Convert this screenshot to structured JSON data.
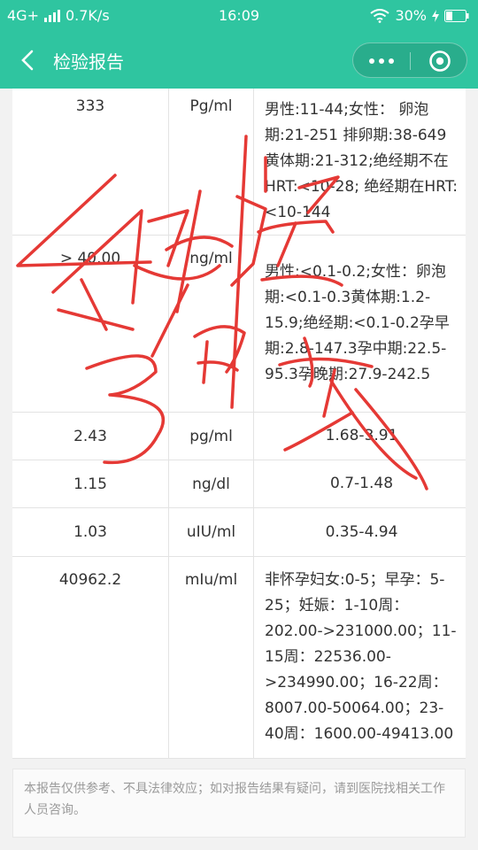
{
  "status_bar": {
    "network": "4G+",
    "speed": "0.7K/s",
    "time": "16:09",
    "battery": "30%"
  },
  "nav": {
    "title": "检验报告"
  },
  "rows": [
    {
      "value": "333",
      "unit": "Pg/ml",
      "reference": "男性:11-44;女性： 卵泡期:21-251 排卵期:38-649 黄体期:21-312;绝经期不在HRT:<10-28; 绝经期在HRT:<10-144"
    },
    {
      "value": "> 40.00",
      "unit": "ng/ml",
      "reference": "男性:<0.1-0.2;女性：卵泡期:<0.1-0.3黄体期:1.2-15.9;绝经期:<0.1-0.2孕早期:2.8-147.3孕中期:22.5-95.3孕晚期:27.9-242.5"
    },
    {
      "value": "2.43",
      "unit": "pg/ml",
      "reference": "1.68-3.91"
    },
    {
      "value": "1.15",
      "unit": "ng/dl",
      "reference": "0.7-1.48"
    },
    {
      "value": "1.03",
      "unit": "uIU/ml",
      "reference": "0.35-4.94"
    },
    {
      "value": "40962.2",
      "unit": "mIu/ml",
      "reference": "非怀孕妇女:0-5；早孕：5-25；妊娠：1-10周：202.00->231000.00；11-15周：22536.00->234990.00；16-22周：8007.00-50064.00；23-40周：1600.00-49413.00"
    }
  ],
  "footer": {
    "disclaimer": "本报告仅供参考、不具法律效应；如对报告结果有疑问，请到医院找相关工作人员咨询。"
  },
  "colors": {
    "accent": "#2fc5a0",
    "annotation": "#e53935"
  },
  "icons": [
    "signal-icon",
    "wifi-icon",
    "charging-icon",
    "battery-icon",
    "back-arrow-icon",
    "more-dots-icon",
    "close-circle-icon"
  ]
}
